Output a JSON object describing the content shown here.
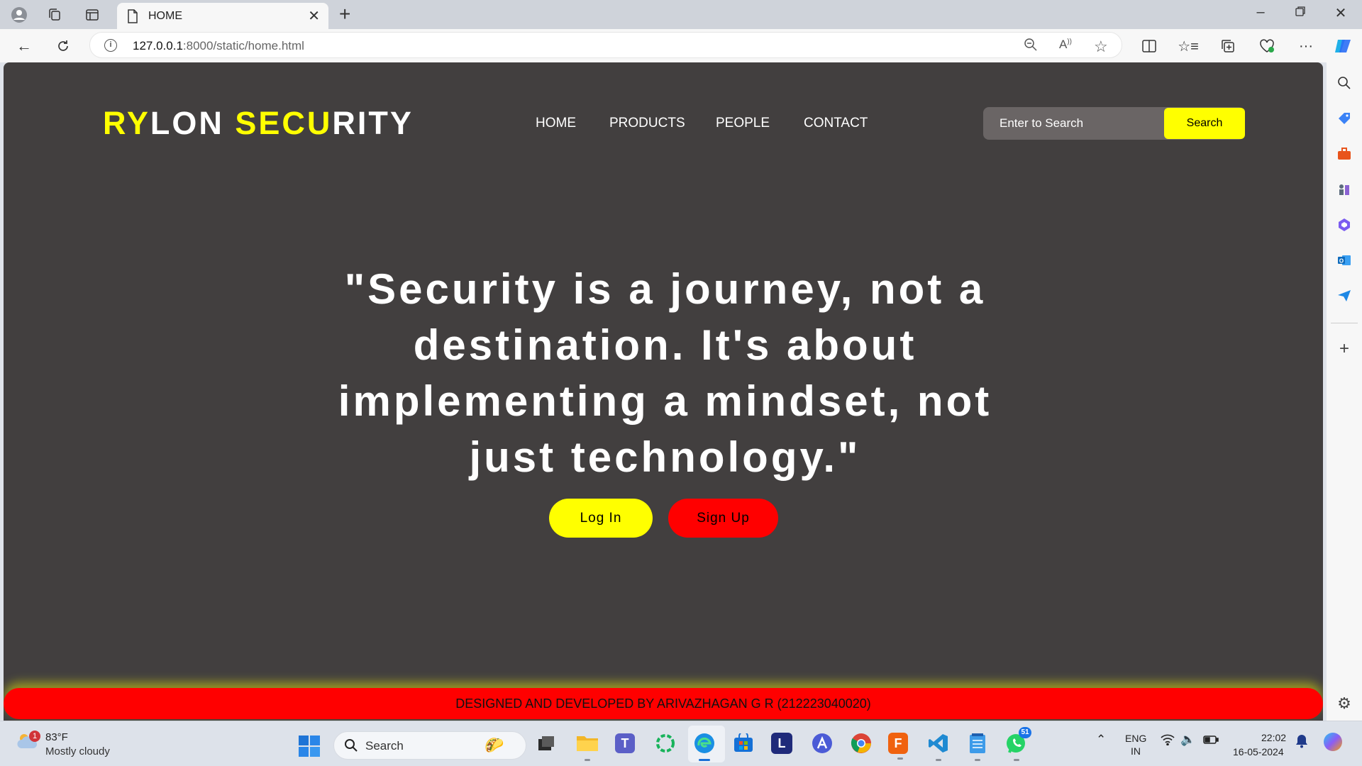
{
  "browser": {
    "tab_title": "HOME",
    "url_host": "127.0.0.1",
    "url_path": ":8000/static/home.html"
  },
  "page": {
    "logo": {
      "part1_yellow": "RY",
      "part1_white": "LON ",
      "part2_yellow": "SECU",
      "part2_white": "RITY"
    },
    "nav": [
      "HOME",
      "PRODUCTS",
      "PEOPLE",
      "CONTACT"
    ],
    "search": {
      "placeholder": "Enter to Search",
      "button": "Search"
    },
    "quote": "\"Security is a journey, not a destination. It's about implementing a mindset, not just technology.\"",
    "login_label": "Log In",
    "signup_label": "Sign Up",
    "footer": "DESIGNED AND DEVELOPED BY ARIVAZHAGAN G R (212223040020)",
    "colors": {
      "background": "#423f3f",
      "accent": "#ffff00",
      "danger": "#ff0000"
    }
  },
  "taskbar": {
    "weather_temp": "83°F",
    "weather_desc": "Mostly cloudy",
    "weather_badge": "1",
    "search_label": "Search",
    "lang_line1": "ENG",
    "lang_line2": "IN",
    "time": "22:02",
    "date": "16-05-2024",
    "whatsapp_badge": "51"
  }
}
